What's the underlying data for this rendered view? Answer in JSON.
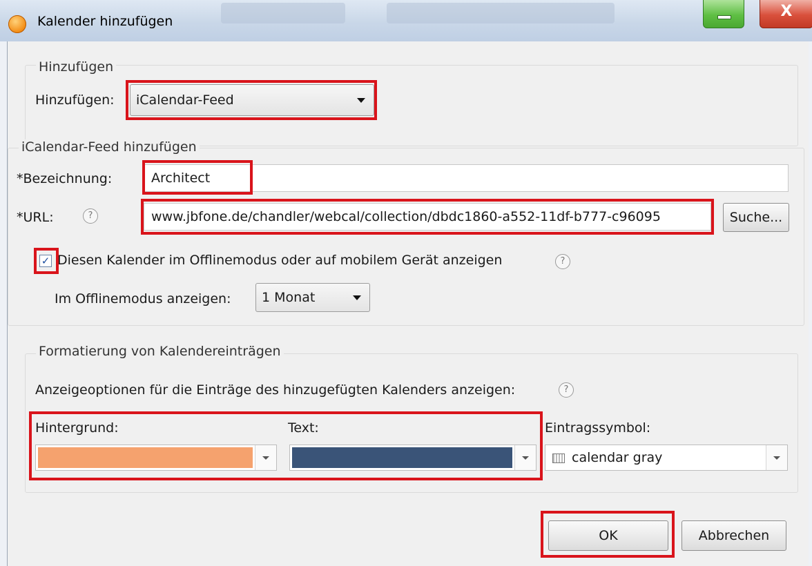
{
  "window": {
    "title": "Kalender hinzufügen",
    "app_icon": "orange-app-icon",
    "close_label": "X"
  },
  "add_group": {
    "title": "Hinzufügen",
    "label": "Hinzufügen:",
    "selected": "iCalendar-Feed"
  },
  "feed_group": {
    "title": "iCalendar-Feed hinzufügen",
    "name_label": "*Bezeichnung:",
    "name_value": "Architect",
    "url_label": "*URL:",
    "url_value": "www.jbfone.de/chandler/webcal/collection/dbdc1860-a552-11df-b777-c96095",
    "browse_label": "Suche...",
    "offline_checked": true,
    "offline_label": "Diesen Kalender im Offlinemodus oder auf mobilem Gerät anzeigen",
    "offline_period_label": "Im Offlinemodus anzeigen:",
    "offline_period_value": "1 Monat"
  },
  "format_group": {
    "title": "Formatierung von Kalendereinträgen",
    "description": "Anzeigeoptionen für die Einträge des hinzugefügten Kalenders anzeigen:",
    "background_label": "Hintergrund:",
    "background_color": "#f5a26e",
    "text_label": "Text:",
    "text_color": "#3a5478",
    "symbol_label": "Eintragssymbol:",
    "symbol_value": "calendar gray"
  },
  "buttons": {
    "ok": "OK",
    "cancel": "Abbrechen"
  },
  "colors": {
    "highlight": "#d9141b",
    "dialog_bg": "#f0f0f0"
  }
}
